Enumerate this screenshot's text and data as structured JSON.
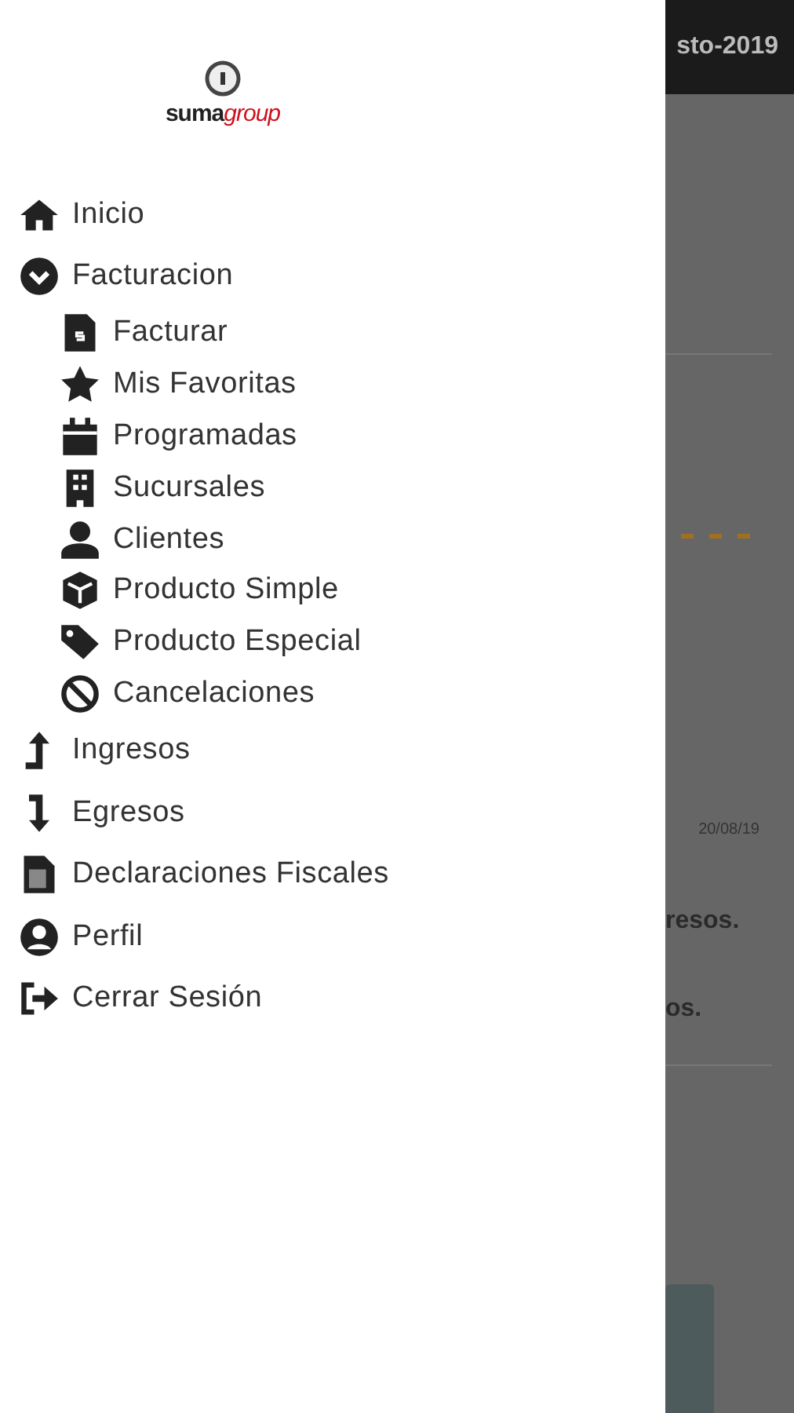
{
  "drawer": {
    "logo": {
      "primary": "suma",
      "accent": "group"
    },
    "items": [
      {
        "kind": "item",
        "label": "Inicio"
      },
      {
        "kind": "group",
        "label": "Facturacion",
        "expanded": true,
        "children": [
          {
            "label": "Facturar"
          },
          {
            "label": "Mis Favoritas"
          },
          {
            "label": "Programadas"
          },
          {
            "label": "Sucursales"
          },
          {
            "label": "Clientes"
          },
          {
            "label": "Producto Simple"
          },
          {
            "label": "Producto Especial"
          },
          {
            "label": "Cancelaciones"
          }
        ]
      },
      {
        "kind": "item",
        "label": "Ingresos"
      },
      {
        "kind": "item",
        "label": "Egresos"
      },
      {
        "kind": "item",
        "label": "Declaraciones Fiscales"
      },
      {
        "kind": "item",
        "label": "Perfil"
      },
      {
        "kind": "item",
        "label": "Cerrar Sesión"
      }
    ]
  },
  "background": {
    "header_title": "sto-2019",
    "date": "20/08/19",
    "text_1": "resos.",
    "text_2": "os."
  }
}
